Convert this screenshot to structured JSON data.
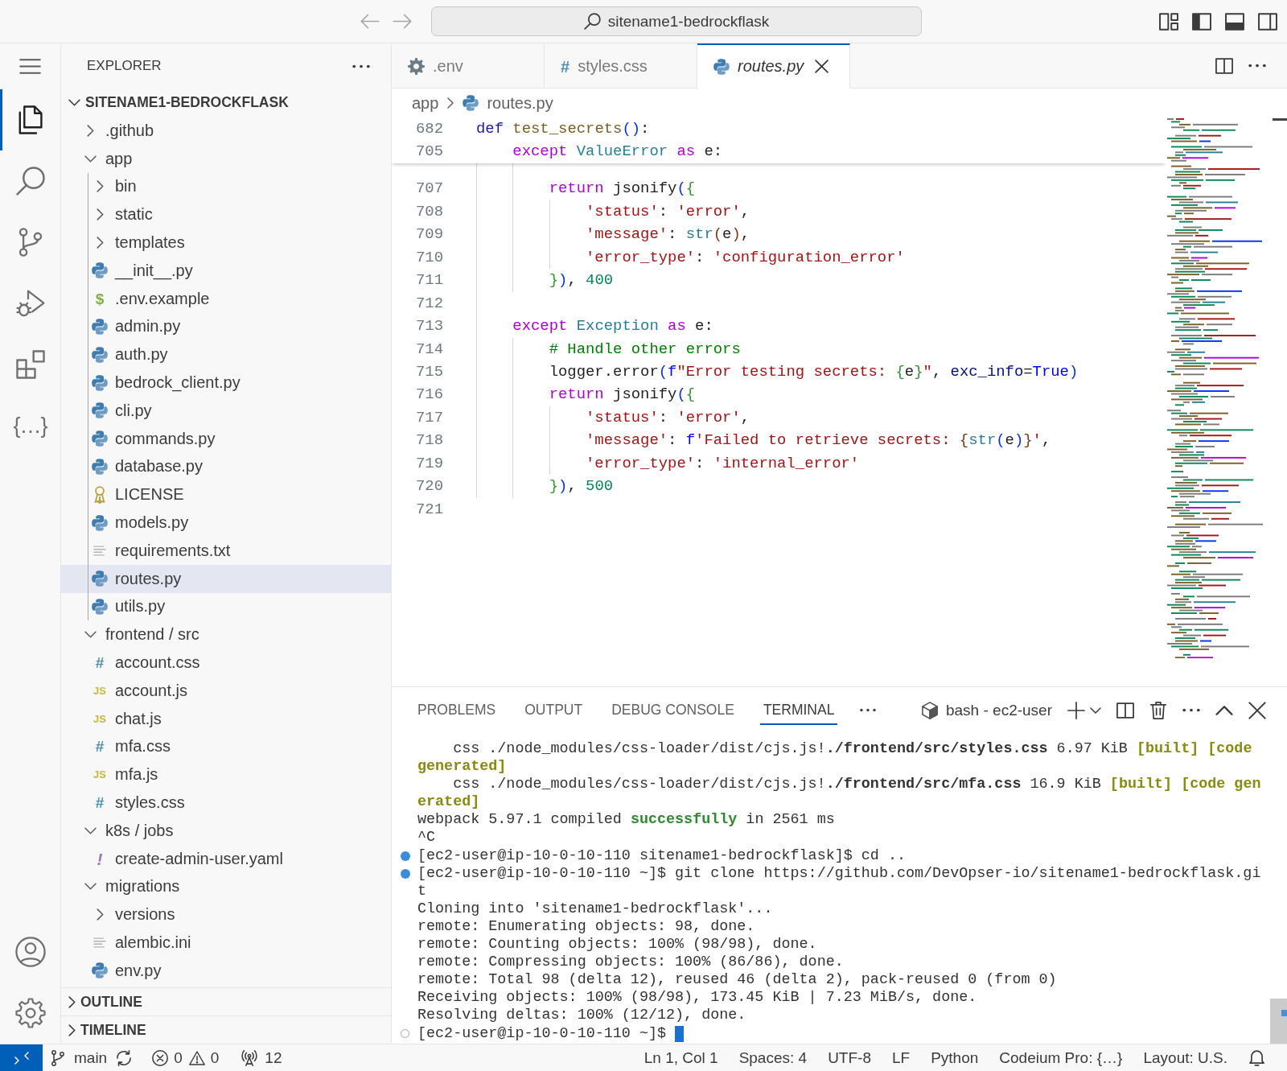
{
  "title_bar": {
    "nav": [
      {
        "kind": "back",
        "disabled": true
      },
      {
        "kind": "forward",
        "disabled": true
      }
    ],
    "search": {
      "text": "sitename1-bedrockflask"
    },
    "layout_toggles": [
      {
        "kind": "primary_sidebar",
        "on": true
      },
      {
        "kind": "panel",
        "on": true
      },
      {
        "kind": "secondary_sidebar",
        "on": false
      }
    ]
  },
  "activity_bar": {
    "items": [
      {
        "kind": "explorer",
        "selected": true
      },
      {
        "kind": "search",
        "selected": false
      },
      {
        "kind": "source_control",
        "selected": false
      },
      {
        "kind": "run_debug",
        "selected": false
      },
      {
        "kind": "extensions",
        "selected": false
      },
      {
        "kind": "glyph",
        "glyph": "{…}",
        "selected": false
      }
    ]
  },
  "sidebar": {
    "title": "EXPLORER",
    "sections": [
      {
        "title": "SITENAME1-BEDROCKFLASK",
        "expanded": true,
        "items": [
          {
            "label": ".github",
            "kind": "folder",
            "expanded": false,
            "selected": false
          },
          {
            "label": "app",
            "kind": "folder",
            "expanded": true,
            "selected": false,
            "children": [
              {
                "label": "bin",
                "kind": "folder",
                "expanded": false,
                "selected": false
              },
              {
                "label": "static",
                "kind": "folder",
                "expanded": false,
                "selected": false
              },
              {
                "label": "templates",
                "kind": "folder",
                "expanded": false,
                "selected": false
              },
              {
                "label": "__init__.py",
                "kind": "python",
                "selected": false
              },
              {
                "label": ".env.example",
                "kind": "env",
                "glyph": "$",
                "selected": false
              },
              {
                "label": "admin.py",
                "kind": "python",
                "selected": false
              },
              {
                "label": "auth.py",
                "kind": "python",
                "selected": false
              },
              {
                "label": "bedrock_client.py",
                "kind": "python",
                "selected": false
              },
              {
                "label": "cli.py",
                "kind": "python",
                "selected": false
              },
              {
                "label": "commands.py",
                "kind": "python",
                "selected": false
              },
              {
                "label": "database.py",
                "kind": "python",
                "selected": false
              },
              {
                "label": "LICENSE",
                "kind": "license",
                "selected": false
              },
              {
                "label": "models.py",
                "kind": "python",
                "selected": false
              },
              {
                "label": "requirements.txt",
                "kind": "text",
                "selected": false
              },
              {
                "label": "routes.py",
                "kind": "python",
                "selected": true
              },
              {
                "label": "utils.py",
                "kind": "python",
                "selected": false
              }
            ]
          },
          {
            "label": "frontend / src",
            "kind": "folder",
            "expanded": true,
            "selected": false,
            "children": [
              {
                "label": "account.css",
                "kind": "css",
                "glyph": "#",
                "selected": false
              },
              {
                "label": "account.js",
                "kind": "js",
                "glyph": "JS",
                "selected": false
              },
              {
                "label": "chat.js",
                "kind": "js",
                "glyph": "JS",
                "selected": false
              },
              {
                "label": "mfa.css",
                "kind": "css",
                "glyph": "#",
                "selected": false
              },
              {
                "label": "mfa.js",
                "kind": "js",
                "glyph": "JS",
                "selected": false
              },
              {
                "label": "styles.css",
                "kind": "css",
                "glyph": "#",
                "selected": false
              }
            ]
          },
          {
            "label": "k8s / jobs",
            "kind": "folder",
            "expanded": true,
            "selected": false,
            "children": [
              {
                "label": "create-admin-user.yaml",
                "kind": "yaml",
                "glyph": "!",
                "selected": false
              }
            ]
          },
          {
            "label": "migrations",
            "kind": "folder",
            "expanded": true,
            "selected": false,
            "children": [
              {
                "label": "versions",
                "kind": "folder",
                "expanded": false,
                "selected": false
              },
              {
                "label": "alembic.ini",
                "kind": "text",
                "selected": false
              },
              {
                "label": "env.py",
                "kind": "python",
                "selected": false
              }
            ]
          }
        ]
      },
      {
        "title": "OUTLINE",
        "expanded": false
      },
      {
        "title": "TIMELINE",
        "expanded": false
      }
    ]
  },
  "editor": {
    "tabs": [
      {
        "label": ".env",
        "kind": "config",
        "selected": false,
        "preview": false
      },
      {
        "label": "styles.css",
        "kind": "css",
        "glyph": "#",
        "selected": false,
        "preview": false
      },
      {
        "label": "routes.py",
        "kind": "python",
        "selected": true,
        "preview": true
      }
    ],
    "breadcrumbs": [
      {
        "label": "app",
        "kind": "folder"
      },
      {
        "label": "routes.py",
        "kind": "python"
      }
    ],
    "sticky_lines": [
      {
        "number": "682",
        "tokens": [
          {
            "text": "def ",
            "kind": "storage"
          },
          {
            "text": "test_secrets",
            "kind": "function"
          },
          {
            "text": "()",
            "kind": "bracket1"
          },
          {
            "text": ":",
            "kind": "plain"
          }
        ]
      },
      {
        "number": "705",
        "tokens": [
          {
            "text": "    except ",
            "kind": "keyword"
          },
          {
            "text": "ValueError ",
            "kind": "type"
          },
          {
            "text": "as ",
            "kind": "keyword"
          },
          {
            "text": "e:",
            "kind": "plain"
          }
        ]
      }
    ],
    "lines": [
      {
        "number": "707",
        "tokens": [
          {
            "text": "        return ",
            "kind": "keyword"
          },
          {
            "text": "jsonify",
            "kind": "plain"
          },
          {
            "text": "(",
            "kind": "bracket1"
          },
          {
            "text": "{",
            "kind": "bracket2"
          }
        ]
      },
      {
        "number": "708",
        "tokens": [
          {
            "text": "            'status'",
            "kind": "string"
          },
          {
            "text": ": ",
            "kind": "plain"
          },
          {
            "text": "'error'",
            "kind": "string"
          },
          {
            "text": ",",
            "kind": "plain"
          }
        ]
      },
      {
        "number": "709",
        "tokens": [
          {
            "text": "            'message'",
            "kind": "string"
          },
          {
            "text": ": ",
            "kind": "plain"
          },
          {
            "text": "str",
            "kind": "type"
          },
          {
            "text": "(",
            "kind": "bracket3"
          },
          {
            "text": "e",
            "kind": "plain"
          },
          {
            "text": ")",
            "kind": "bracket3"
          },
          {
            "text": ",",
            "kind": "plain"
          }
        ]
      },
      {
        "number": "710",
        "tokens": [
          {
            "text": "            'error_type'",
            "kind": "string"
          },
          {
            "text": ": ",
            "kind": "plain"
          },
          {
            "text": "'configuration_error'",
            "kind": "string"
          }
        ]
      },
      {
        "number": "711",
        "tokens": [
          {
            "text": "        }",
            "kind": "bracket2"
          },
          {
            "text": ")",
            "kind": "bracket1"
          },
          {
            "text": ", ",
            "kind": "plain"
          },
          {
            "text": "400",
            "kind": "number"
          }
        ]
      },
      {
        "number": "712"
      },
      {
        "number": "713",
        "tokens": [
          {
            "text": "    except ",
            "kind": "keyword"
          },
          {
            "text": "Exception ",
            "kind": "type"
          },
          {
            "text": "as ",
            "kind": "keyword"
          },
          {
            "text": "e:",
            "kind": "plain"
          }
        ]
      },
      {
        "number": "714",
        "tokens": [
          {
            "text": "        # Handle other errors",
            "kind": "comment"
          }
        ]
      },
      {
        "number": "715",
        "tokens": [
          {
            "text": "        logger.error",
            "kind": "plain"
          },
          {
            "text": "(",
            "kind": "bracket1"
          },
          {
            "text": "f",
            "kind": "constant"
          },
          {
            "text": "\"Error testing secrets: ",
            "kind": "string"
          },
          {
            "text": "{",
            "kind": "bracket2"
          },
          {
            "text": "e",
            "kind": "plain"
          },
          {
            "text": "}",
            "kind": "bracket2"
          },
          {
            "text": "\"",
            "kind": "string"
          },
          {
            "text": ", ",
            "kind": "plain"
          },
          {
            "text": "exc_info",
            "kind": "param"
          },
          {
            "text": "=",
            "kind": "plain"
          },
          {
            "text": "True",
            "kind": "constant"
          },
          {
            "text": ")",
            "kind": "bracket1"
          }
        ]
      },
      {
        "number": "716",
        "tokens": [
          {
            "text": "        return ",
            "kind": "keyword"
          },
          {
            "text": "jsonify",
            "kind": "plain"
          },
          {
            "text": "(",
            "kind": "bracket1"
          },
          {
            "text": "{",
            "kind": "bracket2"
          }
        ]
      },
      {
        "number": "717",
        "tokens": [
          {
            "text": "            'status'",
            "kind": "string"
          },
          {
            "text": ": ",
            "kind": "plain"
          },
          {
            "text": "'error'",
            "kind": "string"
          },
          {
            "text": ",",
            "kind": "plain"
          }
        ]
      },
      {
        "number": "718",
        "tokens": [
          {
            "text": "            'message'",
            "kind": "string"
          },
          {
            "text": ": ",
            "kind": "plain"
          },
          {
            "text": "f",
            "kind": "constant"
          },
          {
            "text": "'Failed to retrieve secrets: ",
            "kind": "string"
          },
          {
            "text": "{",
            "kind": "bracket3"
          },
          {
            "text": "str",
            "kind": "type"
          },
          {
            "text": "(",
            "kind": "bracket1"
          },
          {
            "text": "e",
            "kind": "plain"
          },
          {
            "text": ")",
            "kind": "bracket1"
          },
          {
            "text": "}",
            "kind": "bracket3"
          },
          {
            "text": "'",
            "kind": "string"
          },
          {
            "text": ",",
            "kind": "plain"
          }
        ]
      },
      {
        "number": "719",
        "tokens": [
          {
            "text": "            'error_type'",
            "kind": "string"
          },
          {
            "text": ": ",
            "kind": "plain"
          },
          {
            "text": "'internal_error'",
            "kind": "string"
          }
        ]
      },
      {
        "number": "720",
        "tokens": [
          {
            "text": "        }",
            "kind": "bracket2"
          },
          {
            "text": ")",
            "kind": "bracket1"
          },
          {
            "text": ", ",
            "kind": "plain"
          },
          {
            "text": "500",
            "kind": "number"
          }
        ]
      },
      {
        "number": "721"
      }
    ]
  },
  "panel": {
    "tabs": [
      {
        "label": "PROBLEMS",
        "selected": false
      },
      {
        "label": "OUTPUT",
        "selected": false
      },
      {
        "label": "DEBUG CONSOLE",
        "selected": false
      },
      {
        "label": "TERMINAL",
        "selected": true
      }
    ],
    "terminal": {
      "title": "bash - ec2-user",
      "lines": [
        {
          "kind": "output",
          "segments": [
            {
              "text": "    css ./node_modules/css-loader/dist/cjs.js!",
              "kind": "plain"
            },
            {
              "text": "./frontend/src/styles.css",
              "kind": "bold"
            },
            {
              "text": " 6.97 KiB ",
              "kind": "plain"
            },
            {
              "text": "[built] [code",
              "kind": "tag"
            }
          ]
        },
        {
          "kind": "output",
          "segments": [
            {
              "text": "generated]",
              "kind": "tag"
            }
          ]
        },
        {
          "kind": "output",
          "segments": [
            {
              "text": "    css ./node_modules/css-loader/dist/cjs.js!",
              "kind": "plain"
            },
            {
              "text": "./frontend/src/mfa.css",
              "kind": "bold"
            },
            {
              "text": " 16.9 KiB ",
              "kind": "plain"
            },
            {
              "text": "[built] [code gen",
              "kind": "tag"
            }
          ]
        },
        {
          "kind": "output",
          "segments": [
            {
              "text": "erated]",
              "kind": "tag"
            }
          ]
        },
        {
          "kind": "output",
          "segments": [
            {
              "text": "webpack 5.97.1 compiled ",
              "kind": "plain"
            },
            {
              "text": "successfully",
              "kind": "success"
            },
            {
              "text": " in 2561 ms",
              "kind": "plain"
            }
          ]
        },
        {
          "kind": "output",
          "segments": [
            {
              "text": "^C",
              "kind": "plain"
            }
          ]
        },
        {
          "kind": "succeeded",
          "segments": [
            {
              "text": "[ec2-user@ip-10-0-10-110 sitename1-bedrockflask]$ cd ..",
              "kind": "plain"
            }
          ]
        },
        {
          "kind": "succeeded",
          "segments": [
            {
              "text": "[ec2-user@ip-10-0-10-110 ~]$ git clone https://github.com/DevOpser-io/sitename1-bedrockflask.gi",
              "kind": "plain"
            }
          ]
        },
        {
          "kind": "output",
          "segments": [
            {
              "text": "t",
              "kind": "plain"
            }
          ]
        },
        {
          "kind": "output",
          "segments": [
            {
              "text": "Cloning into 'sitename1-bedrockflask'...",
              "kind": "plain"
            }
          ]
        },
        {
          "kind": "output",
          "segments": [
            {
              "text": "remote: Enumerating objects: 98, done.",
              "kind": "plain"
            }
          ]
        },
        {
          "kind": "output",
          "segments": [
            {
              "text": "remote: Counting objects: 100% (98/98), done.",
              "kind": "plain"
            }
          ]
        },
        {
          "kind": "output",
          "segments": [
            {
              "text": "remote: Compressing objects: 100% (86/86), done.",
              "kind": "plain"
            }
          ]
        },
        {
          "kind": "output",
          "segments": [
            {
              "text": "remote: Total 98 (delta 12), reused 46 (delta 2), pack-reused 0 (from 0)",
              "kind": "plain"
            }
          ]
        },
        {
          "kind": "output",
          "segments": [
            {
              "text": "Receiving objects: 100% (98/98), 173.45 KiB | 7.23 MiB/s, done.",
              "kind": "plain"
            }
          ]
        },
        {
          "kind": "output",
          "segments": [
            {
              "text": "Resolving deltas: 100% (12/12), done.",
              "kind": "plain"
            }
          ]
        },
        {
          "kind": "pending",
          "segments": [
            {
              "text": "[ec2-user@ip-10-0-10-110 ~]$",
              "kind": "plain"
            }
          ]
        }
      ]
    }
  },
  "status_bar": {
    "branch": "main",
    "errors": "0",
    "warnings": "0",
    "ports": "12",
    "items": [
      "Ln 1, Col 1",
      "Spaces: 4",
      "UTF-8",
      "LF",
      "Python",
      "Codeium Pro: {…}",
      "Layout: U.S."
    ]
  }
}
